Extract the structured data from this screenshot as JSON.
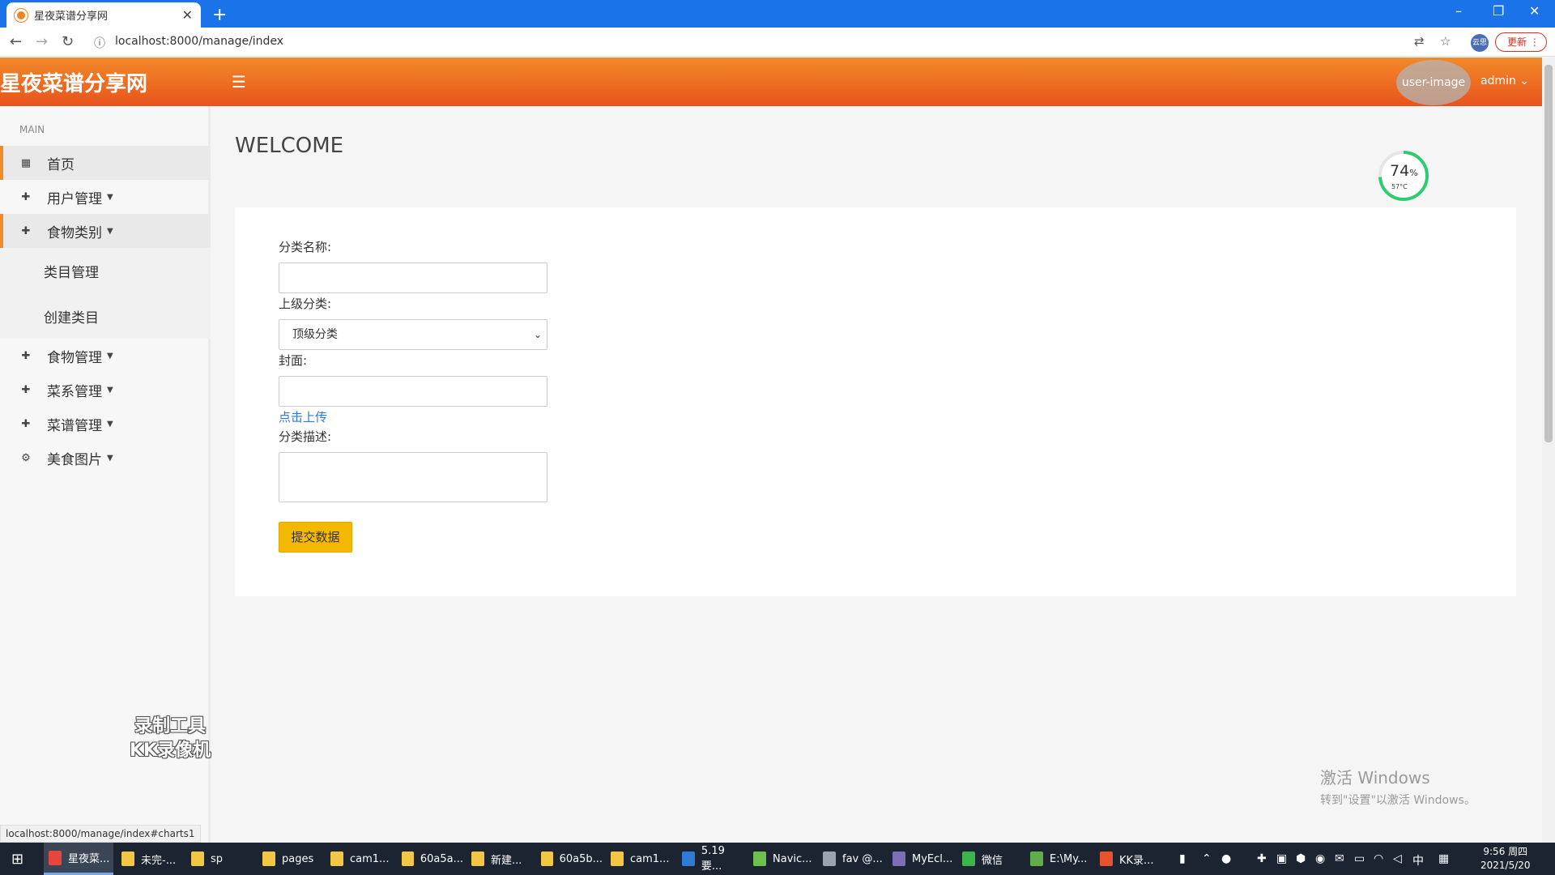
{
  "browser": {
    "tab_title": "星夜菜谱分享网",
    "url": "localhost:8000/manage/index",
    "update_label": "更新",
    "profile_label": "云思",
    "status_url": "localhost:8000/manage/index#charts1"
  },
  "header": {
    "brand": "星夜菜谱分享网",
    "user_image_alt": "user-image",
    "user_name": "admin"
  },
  "sidebar": {
    "section": "MAIN",
    "items": [
      {
        "label": "首页"
      },
      {
        "label": "用户管理"
      },
      {
        "label": "食物类别"
      },
      {
        "label": "食物管理"
      },
      {
        "label": "菜系管理"
      },
      {
        "label": "菜谱管理"
      },
      {
        "label": "美食图片"
      }
    ],
    "subitems": [
      {
        "label": "类目管理"
      },
      {
        "label": "创建类目"
      }
    ]
  },
  "main": {
    "title": "WELCOME",
    "gauge": {
      "percent": "74",
      "unit": "%",
      "temp": "57°C",
      "level": 0.74
    },
    "form": {
      "name_label": "分类名称:",
      "name_value": "",
      "parent_label": "上级分类:",
      "parent_selected": "顶级分类",
      "cover_label": "封面:",
      "cover_value": "",
      "upload_label": "点击上传",
      "desc_label": "分类描述:",
      "desc_value": "",
      "submit_label": "提交数据"
    }
  },
  "watermark": {
    "line1": "录制工具",
    "line2": "KK录像机"
  },
  "activation": {
    "line1": "激活 Windows",
    "line2": "转到\"设置\"以激活 Windows。"
  },
  "taskbar": {
    "items": [
      {
        "label": "星夜菜...",
        "color": "#e8453c"
      },
      {
        "label": "未完-...",
        "color": "#f2c744"
      },
      {
        "label": "sp",
        "color": "#f2c744"
      },
      {
        "label": "pages",
        "color": "#f2c744"
      },
      {
        "label": "cam1...",
        "color": "#f2c744"
      },
      {
        "label": "60a5a...",
        "color": "#f2c744"
      },
      {
        "label": "新建...",
        "color": "#f2c744"
      },
      {
        "label": "60a5b...",
        "color": "#f2c744"
      },
      {
        "label": "cam1...",
        "color": "#f2c744"
      },
      {
        "label": "5.19要...",
        "color": "#2f7bd6"
      },
      {
        "label": "Navic...",
        "color": "#6cc24a"
      },
      {
        "label": "fav @...",
        "color": "#9aa4b1"
      },
      {
        "label": "MyEcl...",
        "color": "#7d6fb5"
      },
      {
        "label": "微信",
        "color": "#3bb44a"
      },
      {
        "label": "E:\\My...",
        "color": "#5fae4b"
      },
      {
        "label": "KK录...",
        "color": "#e8532c"
      }
    ],
    "ime": "中",
    "time": "9:56 周四",
    "date": "2021/5/20"
  }
}
